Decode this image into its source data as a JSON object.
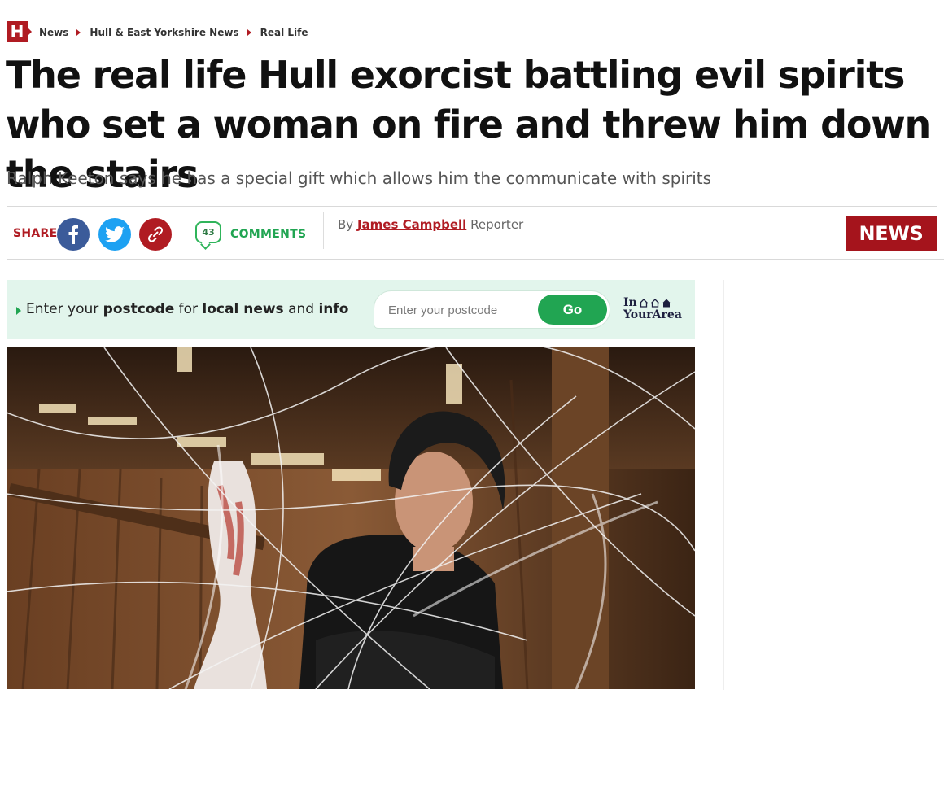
{
  "brand": {
    "logo_letter": "H",
    "accent_color": "#b01b22"
  },
  "breadcrumb": [
    "News",
    "Hull & East Yorkshire News",
    "Real Life"
  ],
  "article": {
    "headline": "The real life Hull exorcist battling evil spirits who set a woman on fire and threw him down the stairs",
    "standfirst": "Ralph Keeton says he has a special gift which allows him the communicate with spirits",
    "byline_prefix": "By",
    "author": "James Campbell",
    "author_role": "Reporter",
    "section_badge": "NEWS"
  },
  "share": {
    "label": "SHARE",
    "buttons": [
      {
        "name": "facebook",
        "icon": "facebook-icon",
        "color": "#3b5b9a"
      },
      {
        "name": "twitter",
        "icon": "twitter-icon",
        "color": "#1da1f2"
      },
      {
        "name": "copy-link",
        "icon": "link-icon",
        "color": "#b01b22"
      }
    ],
    "comments_count": "43",
    "comments_label": "COMMENTS"
  },
  "postcode": {
    "prompt_parts": [
      "Enter your ",
      "postcode",
      " for ",
      "local news",
      " and ",
      "info"
    ],
    "placeholder": "Enter your postcode",
    "button_label": "Go",
    "brand_line1": "In",
    "brand_line2": "YourArea",
    "accent_color": "#21a552"
  },
  "hero_image": {
    "alt": "Ralph Keeton in a barn covered in cobwebs"
  }
}
